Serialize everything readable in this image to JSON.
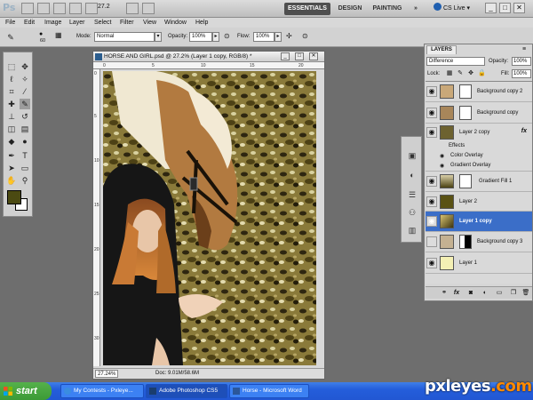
{
  "app": {
    "logo": "Ps",
    "zoom": "27.2",
    "workspaces": [
      "ESSENTIALS",
      "DESIGN",
      "PAINTING"
    ],
    "more": "»",
    "cslive": "CS Live",
    "window_controls": [
      "_",
      "□",
      "✕"
    ]
  },
  "menu": [
    "File",
    "Edit",
    "Image",
    "Layer",
    "Select",
    "Filter",
    "View",
    "Window",
    "Help"
  ],
  "options": {
    "brush_size": "60",
    "mode_label": "Mode:",
    "mode_value": "Normal",
    "opacity_label": "Opacity:",
    "opacity_value": "100%",
    "flow_label": "Flow:",
    "flow_value": "100%"
  },
  "document": {
    "title": "HORSE AND GIRL.psd @ 27.2% (Layer 1 copy, RGB/8) *",
    "controls": [
      "_",
      "□",
      "✕"
    ],
    "ruler_top": [
      "0",
      "5",
      "10",
      "15",
      "20"
    ],
    "ruler_left": [
      "0",
      "5",
      "10",
      "15",
      "20",
      "25",
      "30"
    ],
    "zoom": "27.24%",
    "doc_size": "Doc: 9.01M/58.6M"
  },
  "layers_panel": {
    "tab": "LAYERS",
    "menu": "≡",
    "blend_mode": "Difference",
    "opacity_label": "Opacity:",
    "opacity_value": "100%",
    "lock_label": "Lock:",
    "fill_label": "Fill:",
    "fill_value": "100%",
    "layers": [
      {
        "name": "Background copy 2",
        "visible": true,
        "selected": false
      },
      {
        "name": "Background copy",
        "visible": true,
        "selected": false
      },
      {
        "name": "Layer 2 copy",
        "visible": true,
        "selected": false,
        "fx": "fx"
      },
      {
        "name": "Effects",
        "visible": false,
        "selected": false
      },
      {
        "name": "Color Overlay",
        "visible": true,
        "selected": false
      },
      {
        "name": "Gradient Overlay",
        "visible": true,
        "selected": false
      },
      {
        "name": "Gradient Fill 1",
        "visible": true,
        "selected": false
      },
      {
        "name": "Layer 2",
        "visible": true,
        "selected": false
      },
      {
        "name": "Layer 1 copy",
        "visible": true,
        "selected": true
      },
      {
        "name": "Background copy 3",
        "visible": false,
        "selected": false
      },
      {
        "name": "Layer 1",
        "visible": true,
        "selected": false
      }
    ]
  },
  "taskbar": {
    "start": "start",
    "tasks": [
      {
        "label": "My Contests - Pxleye...",
        "active": false
      },
      {
        "label": "Adobe Photoshop CS5",
        "active": true
      },
      {
        "label": "Horse - Microsoft Word",
        "active": false
      }
    ]
  },
  "watermark": {
    "brand": "pxleyes",
    "tld": ".com"
  },
  "colors": {
    "accent_selected": "#3b6ec8",
    "foreground_swatch": "#4b4a12",
    "background_swatch": "#ffffff",
    "taskbar": "#245edb",
    "start_button": "#3c9a36"
  }
}
